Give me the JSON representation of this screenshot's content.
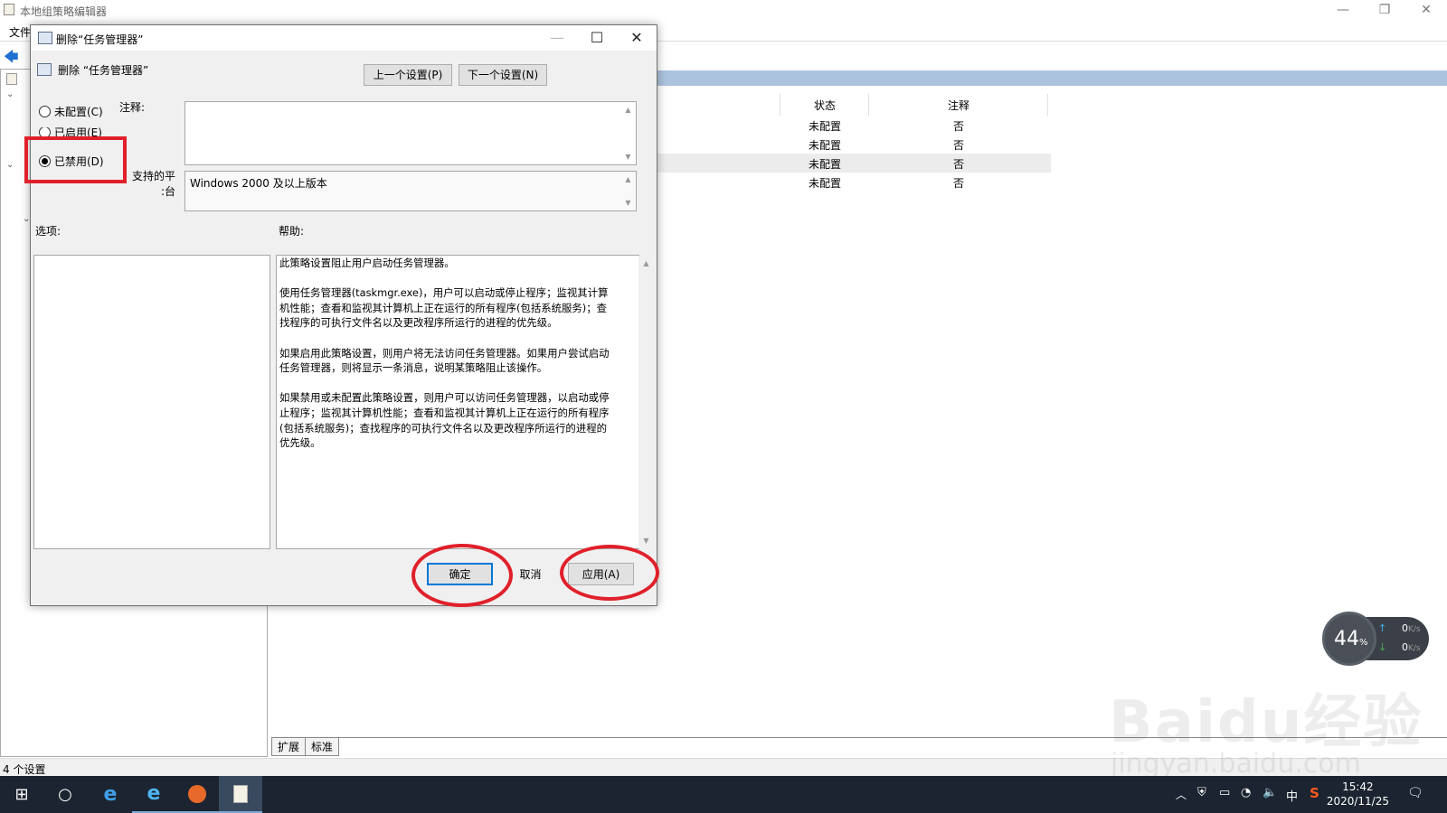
{
  "main_window": {
    "title": "本地组策略编辑器",
    "menu_file": "文件",
    "window_controls": [
      "—",
      "❐",
      "✕"
    ],
    "columns": [
      "状态",
      "注释"
    ],
    "rows": [
      {
        "state": "未配置",
        "comment": "否"
      },
      {
        "state": "未配置",
        "comment": "否"
      },
      {
        "state": "未配置",
        "comment": "否",
        "selected": true
      },
      {
        "state": "未配置",
        "comment": "否"
      }
    ],
    "tabs": [
      "扩展",
      "标准"
    ],
    "status": "4 个设置"
  },
  "dialog": {
    "title": "删除“任务管理器”",
    "policy_name": "删除 “任务管理器”",
    "prev_button": "上一个设置(P)",
    "next_button": "下一个设置(N)",
    "radio_not_configured": "未配置(C)",
    "radio_enabled": "已启用(E)",
    "radio_disabled": "已禁用(D)",
    "selected_option": "disabled",
    "comment_label": "注释:",
    "platform_label": "支持的平台:",
    "platform_value": "Windows 2000 及以上版本",
    "options_label": "选项:",
    "help_label": "帮助:",
    "help_paragraphs": [
      "此策略设置阻止用户启动任务管理器。",
      "使用任务管理器(taskmgr.exe)，用户可以启动或停止程序；监视其计算机性能；查看和监视其计算机上正在运行的所有程序(包括系统服务)；查找程序的可执行文件名以及更改程序所运行的进程的优先级。",
      "如果启用此策略设置，则用户将无法访问任务管理器。如果用户尝试启动任务管理器，则将显示一条消息，说明某策略阻止该操作。",
      "如果禁用或未配置此策略设置，则用户可以访问任务管理器，以启动或停止程序；监视其计算机性能；查看和监视其计算机上正在运行的所有程序(包括系统服务)；查找程序的可执行文件名以及更改程序所运行的进程的优先级。"
    ],
    "ok_button": "确定",
    "cancel_button": "取消",
    "apply_button": "应用(A)"
  },
  "net_widget": {
    "percent": "44",
    "percent_unit": "%",
    "up": "0",
    "down": "0",
    "unit": "K/s"
  },
  "taskbar": {
    "time": "15:42",
    "date": "2020/11/25",
    "ime": "中"
  },
  "watermark": {
    "main": "Baidu经验",
    "sub": "jingyan.baidu.com"
  },
  "colors": {
    "annotation": "#e0202a",
    "header_band": "#abc3dd",
    "taskbar": "#1b2430"
  }
}
